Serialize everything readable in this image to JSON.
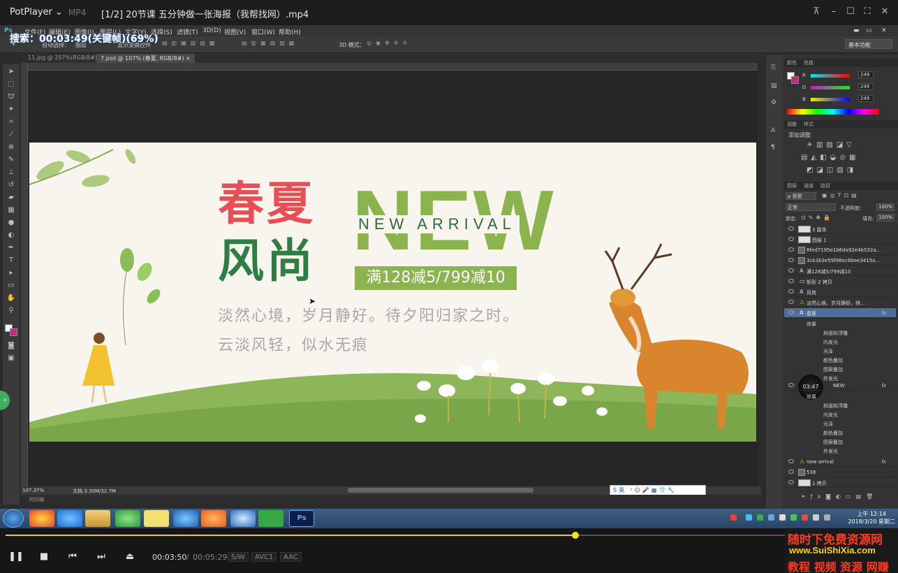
{
  "player": {
    "brand": "PotPlayer",
    "format": "MP4",
    "file_title": "[1/2] 20节课 五分钟做一张海报（我帮找网）.mp4",
    "search_overlay": "搜索：00:03:49(关键帧)(69%)",
    "time_current": "00:03:50",
    "time_separator": "/",
    "time_total": "00:05:29",
    "badges": [
      "S/W",
      "AVC1",
      "AAC"
    ],
    "progress": 0.73,
    "accent_color": "#e3d21c"
  },
  "photoshop": {
    "menu": [
      "文件(F)",
      "编辑(E)",
      "图像(I)",
      "图层(L)",
      "文字(Y)",
      "选择(S)",
      "滤镜(T)",
      "3D(D)",
      "视图(V)",
      "窗口(W)",
      "帮助(H)"
    ],
    "options_bar": {
      "auto_select": "自动选择：",
      "group": "图层",
      "transform": "显示变换控件",
      "mode_3d": "3D 模式："
    },
    "workspace": "基本功能",
    "tabs": [
      "11.jpg @ 257%(RGB/8#)",
      "7.psd @ 107% (春夏, RGB/8#)"
    ],
    "status": {
      "zoom": "107.37%",
      "doc": "文档:3.30M/32.7M"
    },
    "timeline_tab": "时间轴",
    "video_time_bubble": "03:47",
    "color_panel": {
      "tabs": [
        "颜色",
        "色板"
      ],
      "rows": [
        {
          "label": "R",
          "value": "249"
        },
        {
          "label": "G",
          "value": "249"
        },
        {
          "label": "B",
          "value": "249"
        }
      ]
    },
    "adjust_panel": {
      "tabs": [
        "调整",
        "样式"
      ],
      "title": "添加调整"
    },
    "layers_panel": {
      "tabs": [
        "图层",
        "通道",
        "路径"
      ],
      "kind": "ρ 类型",
      "blend": "正常",
      "opacity_label": "不透明度:",
      "opacity": "100%",
      "lock_label": "锁定:",
      "fill_label": "填充:",
      "fill": "100%",
      "layers": [
        {
          "name": "3 副本"
        },
        {
          "name": "图层 1"
        },
        {
          "name": "6fed7195e1b6da92e4b532a..."
        },
        {
          "name": "3cb3b3e59f96ec6bee3415a..."
        },
        {
          "name": "满128减5/799减10"
        },
        {
          "name": "矩形 2 拷贝"
        },
        {
          "name": "风尚"
        },
        {
          "name": "淡然心境，岁月静好。待..."
        },
        {
          "name": "春夏",
          "fx": "fx"
        }
      ],
      "effects_a": [
        "效果",
        "斜面和浮雕",
        "内发光",
        "光泽",
        "颜色叠加",
        "图案叠加",
        "外发光"
      ],
      "layer_new": {
        "name": "NEW",
        "fx": "fx"
      },
      "effects_b": [
        "效果",
        "斜面和浮雕",
        "内发光",
        "光泽",
        "颜色叠加",
        "图案叠加",
        "外发光"
      ],
      "layers_bottom": [
        {
          "name": "new arrival",
          "fx": "fx"
        },
        {
          "name": "538"
        },
        {
          "name": "1 拷贝"
        }
      ]
    }
  },
  "poster": {
    "title_top": "春夏",
    "title_bottom": "风尚",
    "big_word": "NEW",
    "sub_word": "NEW ARRIVAL",
    "promo": "满128减5/799减10",
    "slogan1": "淡然心境，岁月静好。待夕阳归家之时。",
    "slogan2": "云淡风轻，似水无痕",
    "colors": {
      "red": "#e94e56",
      "green": "#2f7f45",
      "lightgreen": "#8bb44f"
    }
  },
  "taskbar": {
    "clock_time": "上午 12:14",
    "clock_date": "2018/3/20 星期二"
  },
  "watermark": {
    "line1": "随时下免费资源网",
    "line2": "www.SuiShiXia.com",
    "line3": "教程 视频 资源 网赚"
  }
}
